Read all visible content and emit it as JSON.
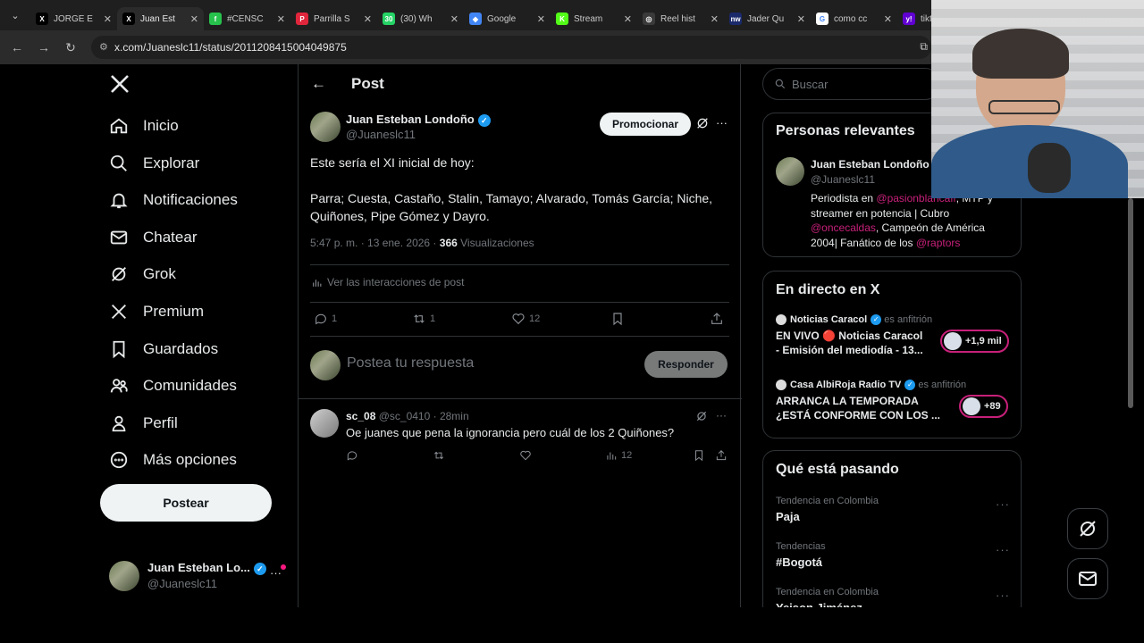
{
  "browser": {
    "tabs": [
      {
        "title": "JORGE E",
        "fav_color": "#000000",
        "fav_glyph": "X",
        "active": false
      },
      {
        "title": "Juan Est",
        "fav_color": "#000000",
        "fav_glyph": "X",
        "active": true
      },
      {
        "title": "#CENSC",
        "fav_color": "#27c24c",
        "fav_glyph": "f",
        "active": false
      },
      {
        "title": "Parrilla S",
        "fav_color": "#e0263c",
        "fav_glyph": "P",
        "active": false
      },
      {
        "title": "(30) Wh",
        "fav_color": "#25d366",
        "fav_glyph": "30",
        "active": false
      },
      {
        "title": "Google",
        "fav_color": "#4285f4",
        "fav_glyph": "◆",
        "active": false
      },
      {
        "title": "Stream",
        "fav_color": "#53fc18",
        "fav_glyph": "K",
        "active": false
      },
      {
        "title": "Reel hist",
        "fav_color": "#3a3a3a",
        "fav_glyph": "◎",
        "active": false
      },
      {
        "title": "Jader Qu",
        "fav_color": "#1b2a6b",
        "fav_glyph": "nw",
        "active": false
      },
      {
        "title": "como cc",
        "fav_color": "#ffffff",
        "fav_glyph": "G",
        "active": false
      },
      {
        "title": "tiktok",
        "fav_color": "#6001d2",
        "fav_glyph": "y!",
        "active": false
      }
    ],
    "url": "x.com/Juaneslc11/status/2011208415004049875"
  },
  "sidebar": {
    "items": [
      {
        "label": "Inicio",
        "icon": "home-icon"
      },
      {
        "label": "Explorar",
        "icon": "search-icon"
      },
      {
        "label": "Notificaciones",
        "icon": "bell-icon"
      },
      {
        "label": "Chatear",
        "icon": "mail-icon"
      },
      {
        "label": "Grok",
        "icon": "grok-icon"
      },
      {
        "label": "Premium",
        "icon": "x-logo-icon"
      },
      {
        "label": "Guardados",
        "icon": "bookmark-icon"
      },
      {
        "label": "Comunidades",
        "icon": "people-icon"
      },
      {
        "label": "Perfil",
        "icon": "person-icon"
      },
      {
        "label": "Más opciones",
        "icon": "more-circle-icon"
      }
    ],
    "post_button": "Postear",
    "account": {
      "name": "Juan Esteban Lo...",
      "handle": "@Juaneslc11"
    }
  },
  "post": {
    "header_title": "Post",
    "author_name": "Juan Esteban Londoño",
    "author_handle": "@Juaneslc11",
    "promote_label": "Promocionar",
    "text_line1": "Este sería el XI inicial de hoy:",
    "text_line2": "Parra; Cuesta, Castaño, Stalin, Tamayo; Alvarado, Tomás García; Niche,",
    "text_line3": "Quiñones, Pipe Gómez y Dayro.",
    "timestamp": "5:47 p. m. · 13 ene. 2026 · ",
    "views_count": "366",
    "views_label": "Visualizaciones",
    "interactions_label": "Ver las interacciones de post",
    "replies": "1",
    "reposts": "1",
    "likes": "12",
    "reply_placeholder": "Postea tu respuesta",
    "reply_button": "Responder"
  },
  "reply": {
    "author_name": "sc_08",
    "author_handle": "@sc_0410",
    "time": "· 28min",
    "text": "Oe juanes que pena la ignorancia pero cuál de los 2 Quiñones?",
    "views": "12"
  },
  "search": {
    "placeholder": "Buscar"
  },
  "relevant": {
    "title": "Personas relevantes",
    "name": "Juan Esteban Londoño",
    "handle": "@Juaneslc11",
    "bio_a": "Periodista en ",
    "bio_link1": "@pasionblancaff",
    "bio_b": ", MTP y",
    "bio_c": "streamer en potencia | Cubro",
    "bio_link2": "@oncecaldas",
    "bio_d": ", Campeón de América",
    "bio_e": "2004| Fanático de los ",
    "bio_link3": "@raptors"
  },
  "live": {
    "title": "En directo en X",
    "items": [
      {
        "host": "Noticias Caracol",
        "host_suffix": "es anfitrión",
        "line1": "EN VIVO 🔴 Noticias Caracol",
        "line2": "- Emisión del mediodía - 13...",
        "count": "+1,9 mil"
      },
      {
        "host": "Casa AlbiRoja Radio TV",
        "host_suffix": "es anfitrión",
        "line1": "ARRANCA LA TEMPORADA",
        "line2": "¿ESTÁ CONFORME CON LOS ...",
        "count": "+89"
      }
    ]
  },
  "trends": {
    "title": "Qué está pasando",
    "items": [
      {
        "meta": "Tendencia en Colombia",
        "name": "Paja"
      },
      {
        "meta": "Tendencias",
        "name": "#Bogotá"
      },
      {
        "meta": "Tendencia en Colombia",
        "name": "Yeison Jiménez"
      }
    ]
  },
  "colors": {
    "accent": "#1d9bf0",
    "link_pink": "#c8207a",
    "background": "#000000"
  }
}
